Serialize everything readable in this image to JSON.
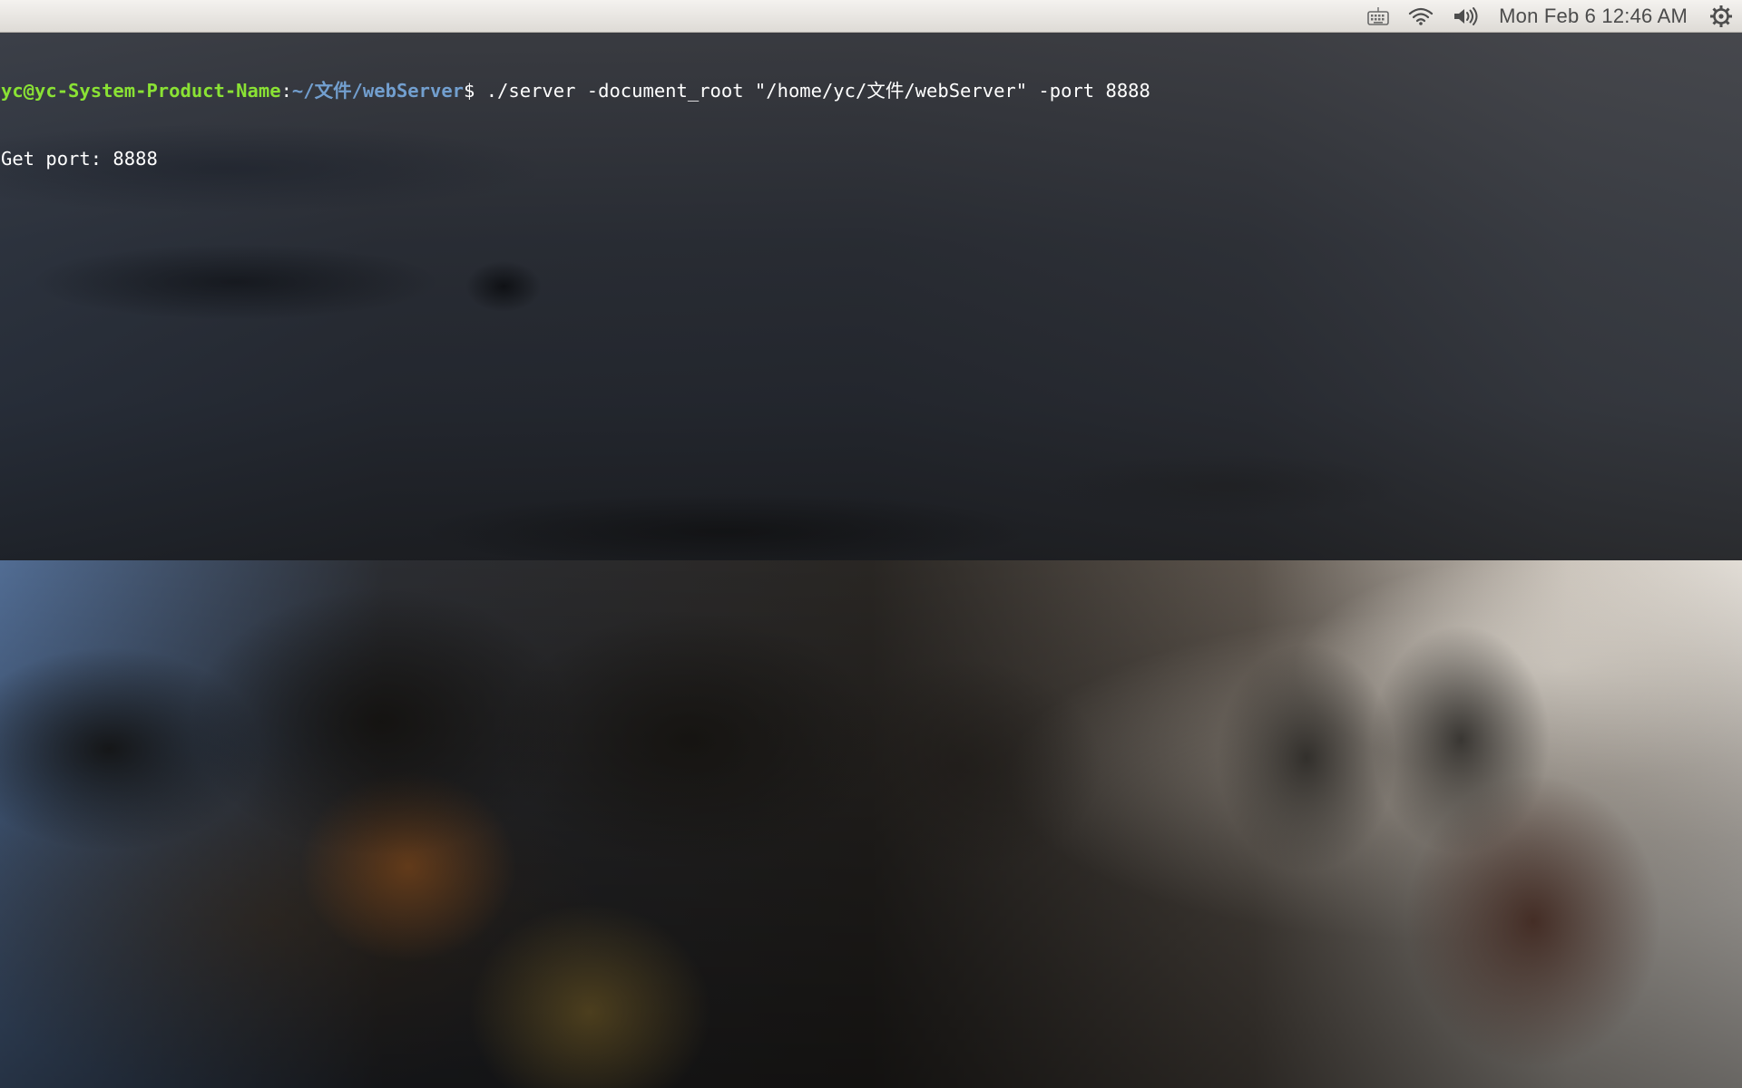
{
  "top_panel": {
    "keyboard_icon": "keyboard-icon",
    "wifi_icon": "wifi-icon",
    "volume_icon": "volume-icon",
    "clock": "Mon Feb  6 12:46 AM",
    "settings_icon": "gear-icon"
  },
  "terminal": {
    "prompt_user_host": "yc@yc-System-Product-Name",
    "prompt_sep": ":",
    "prompt_path": "~/文件/webServer",
    "prompt_symbol": "$ ",
    "command": "./server -document_root \"/home/yc/文件/webServer\" -port 8888",
    "output": [
      "Get port: 8888"
    ]
  },
  "colors": {
    "prompt_user": "#8ae234",
    "prompt_path": "#729fcf",
    "terminal_text": "#ffffff",
    "panel_bg": "#e9e6e1"
  }
}
